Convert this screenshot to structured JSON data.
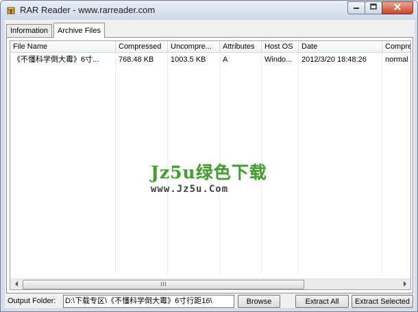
{
  "window": {
    "title": "RAR Reader - www.rarreader.com"
  },
  "tabs": [
    {
      "label": "Information"
    },
    {
      "label": "Archive Files"
    }
  ],
  "columns": [
    {
      "label": "File Name"
    },
    {
      "label": "Compressed"
    },
    {
      "label": "Uncompre..."
    },
    {
      "label": "Attributes"
    },
    {
      "label": "Host OS"
    },
    {
      "label": "Date"
    },
    {
      "label": "Compres"
    }
  ],
  "rows": [
    {
      "file_name": "《不懂科学倒大霉》6寸...",
      "compressed": "768.48 KB",
      "uncompressed": "1003.5 KB",
      "attributes": "A",
      "host_os": "Windo...",
      "date": "2012/3/20 18:48:26",
      "method": "normal"
    }
  ],
  "watermark": {
    "main": "Jz5u绿色下载",
    "sub": "www.Jz5u.Com"
  },
  "bottom": {
    "output_label": "Output Folder:",
    "output_value": "D:\\下载专区\\《不懂科学倒大霉》6寸行距16\\",
    "browse_label": "Browse",
    "extract_all_label": "Extract All",
    "extract_selected_label": "Extract Selected"
  },
  "icons": {
    "app": "archive-icon",
    "minimize": "minimize-icon",
    "maximize": "maximize-icon",
    "close": "close-icon"
  }
}
